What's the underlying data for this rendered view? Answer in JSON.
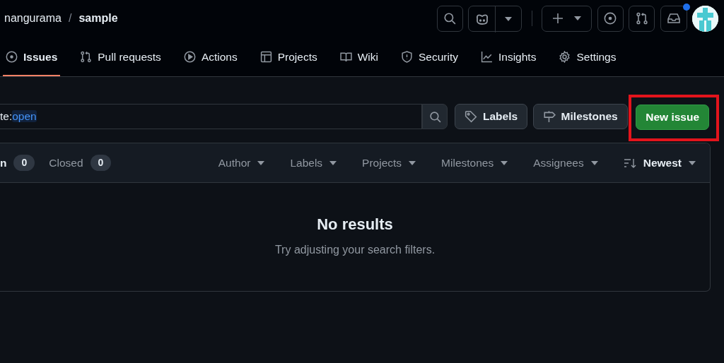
{
  "breadcrumb": {
    "owner": "nangurama",
    "separator": "/",
    "repo": "sample"
  },
  "header_actions": {
    "inbox_unread": true
  },
  "tabs": [
    {
      "label": "Issues",
      "selected": true
    },
    {
      "label": "Pull requests",
      "selected": false
    },
    {
      "label": "Actions",
      "selected": false
    },
    {
      "label": "Projects",
      "selected": false
    },
    {
      "label": "Wiki",
      "selected": false
    },
    {
      "label": "Security",
      "selected": false
    },
    {
      "label": "Insights",
      "selected": false
    },
    {
      "label": "Settings",
      "selected": false
    }
  ],
  "search": {
    "value_prefix": "te:",
    "value_token": "open"
  },
  "buttons": [
    {
      "label": "Labels",
      "kind": "secondary"
    },
    {
      "label": "Milestones",
      "kind": "secondary"
    },
    {
      "label": "New issue",
      "kind": "primary",
      "highlighted": true
    }
  ],
  "state_filters": [
    {
      "label": "n",
      "count": "0",
      "selected": true
    },
    {
      "label": "Closed",
      "count": "0",
      "selected": false
    }
  ],
  "filters": [
    "Author",
    "Labels",
    "Projects",
    "Milestones",
    "Assignees"
  ],
  "sort": {
    "label": "Newest"
  },
  "empty_state": {
    "title": "No results",
    "message": "Try adjusting your search filters."
  }
}
